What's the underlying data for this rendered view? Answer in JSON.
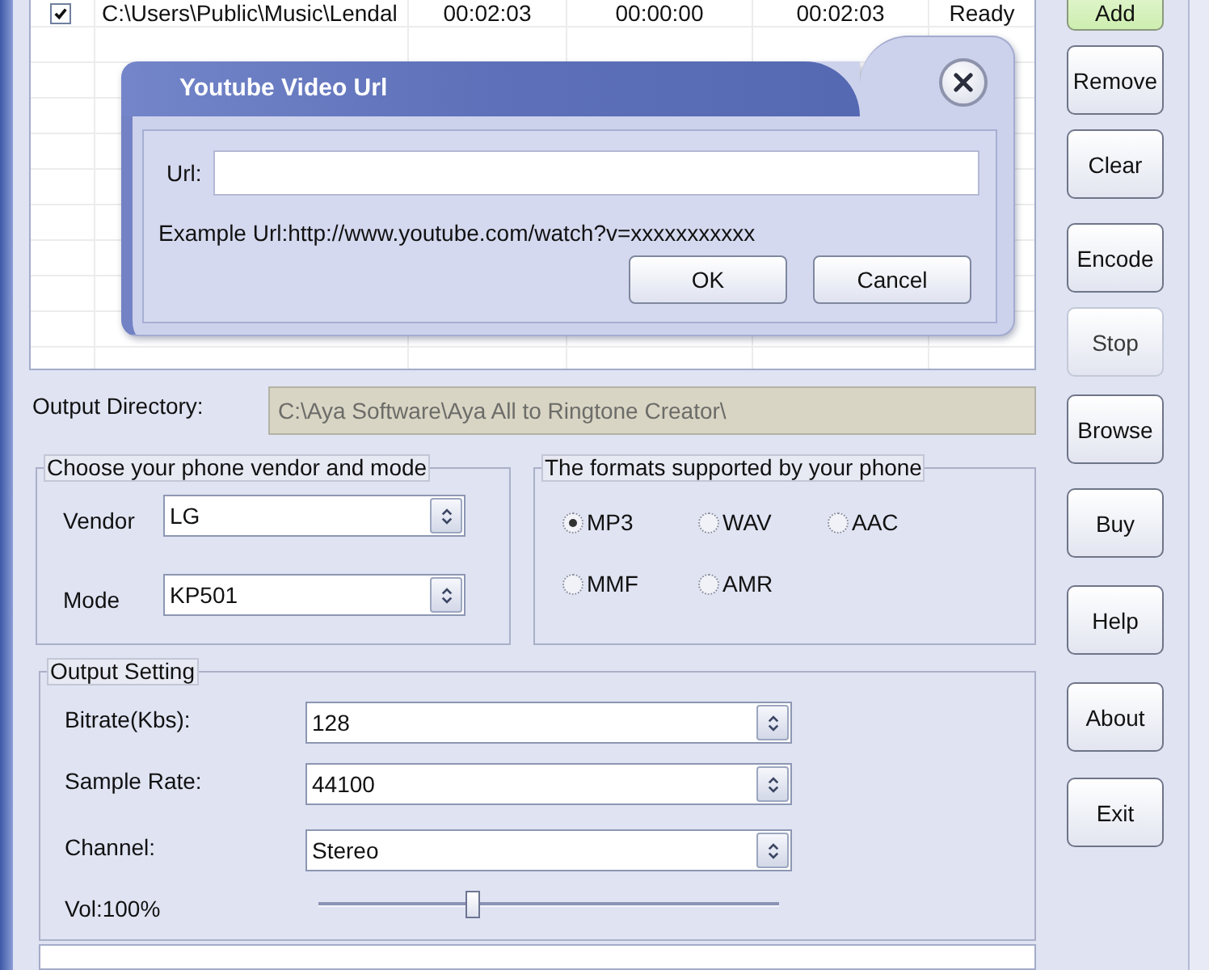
{
  "file_list": {
    "rows": [
      {
        "checked": true,
        "cells": [
          "C:\\Users\\Public\\Music\\Lendal",
          "00:02:03",
          "00:00:00",
          "00:02:03",
          "Ready"
        ]
      }
    ]
  },
  "dialog": {
    "title": "Youtube Video Url",
    "url_label": "Url:",
    "example": "Example Url:http://www.youtube.com/watch?v=xxxxxxxxxxx",
    "buttons": [
      "OK",
      "Cancel"
    ]
  },
  "output_directory": {
    "label": "Output Directory:",
    "value": "C:\\Aya Software\\Aya All to Ringtone Creator\\",
    "disabled": true
  },
  "phone_group": {
    "title": "Choose your phone vendor and mode",
    "fields": [
      {
        "label": "Vendor",
        "value": "LG"
      },
      {
        "label": "Mode",
        "value": "KP501"
      }
    ]
  },
  "formats_group": {
    "title": "The formats supported by your phone",
    "options": [
      {
        "label": "MP3",
        "selected": true
      },
      {
        "label": "WAV",
        "selected": false
      },
      {
        "label": "AAC",
        "selected": false
      },
      {
        "label": "MMF",
        "selected": false
      },
      {
        "label": "AMR",
        "selected": false
      }
    ]
  },
  "output_group": {
    "title": "Output Setting",
    "fields": [
      {
        "label": "Bitrate(Kbs):",
        "value": "128"
      },
      {
        "label": "Sample Rate:",
        "value": "44100"
      },
      {
        "label": "Channel:",
        "value": "Stereo"
      }
    ],
    "volume": {
      "label": "Vol:100%",
      "level": 0.33
    }
  },
  "side_buttons": [
    {
      "label": "Add",
      "highlighted": true,
      "disabled": false
    },
    {
      "label": "Remove",
      "highlighted": false,
      "disabled": false
    },
    {
      "label": "Clear",
      "highlighted": false,
      "disabled": false
    },
    {
      "label": "Encode",
      "highlighted": false,
      "disabled": false
    },
    {
      "label": "Stop",
      "highlighted": false,
      "disabled": true
    },
    {
      "label": "Browse",
      "highlighted": false,
      "disabled": false
    },
    {
      "label": "Buy",
      "highlighted": false,
      "disabled": false
    },
    {
      "label": "Help",
      "highlighted": false,
      "disabled": false
    },
    {
      "label": "About",
      "highlighted": false,
      "disabled": false
    },
    {
      "label": "Exit",
      "highlighted": false,
      "disabled": false
    }
  ]
}
